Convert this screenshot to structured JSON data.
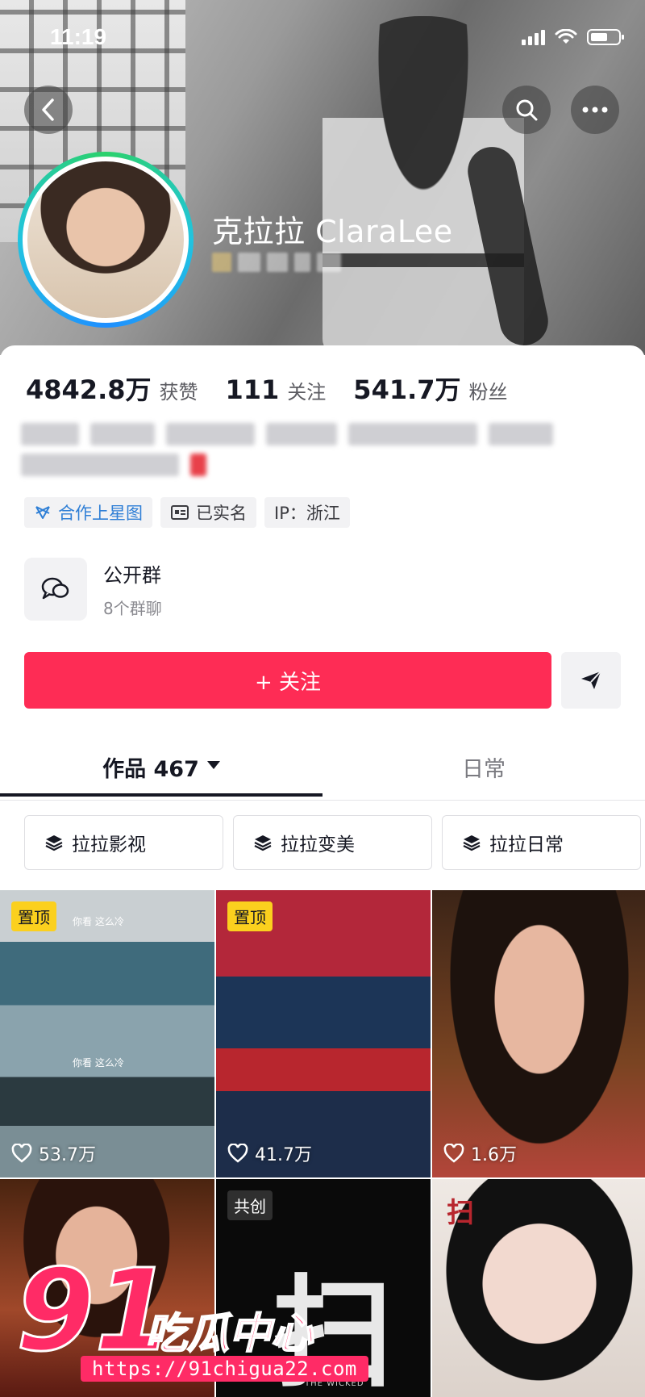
{
  "status_bar": {
    "time": "11:19"
  },
  "profile": {
    "username": "克拉拉 ClaraLee",
    "stats": [
      {
        "value": "4842.8万",
        "label": "获赞"
      },
      {
        "value": "111",
        "label": "关注"
      },
      {
        "value": "541.7万",
        "label": "粉丝"
      }
    ],
    "tags": [
      {
        "icon": "star-map-icon",
        "label": "合作上星图"
      },
      {
        "icon": "id-card-icon",
        "label": "已实名"
      },
      {
        "icon": "",
        "label": "IP：浙江"
      }
    ],
    "group": {
      "title": "公开群",
      "subtitle": "8个群聊"
    },
    "follow_label": "+ 关注"
  },
  "tabs": [
    {
      "label": "作品 467",
      "active": true
    },
    {
      "label": "日常",
      "active": false
    }
  ],
  "collections": [
    {
      "icon": "layers-icon",
      "label": "拉拉影视"
    },
    {
      "icon": "layers-icon",
      "label": "拉拉变美"
    },
    {
      "icon": "layers-icon",
      "label": "拉拉日常"
    }
  ],
  "videos": [
    {
      "badge": "置顶",
      "likes": "53.7万",
      "captions": [
        "你看   这么冷",
        "你看   这么冷"
      ]
    },
    {
      "badge": "置顶",
      "likes": "41.7万"
    },
    {
      "badge": "",
      "likes": "1.6万"
    },
    {
      "badge": "",
      "likes": ""
    },
    {
      "badge": "共创",
      "likes": "",
      "title_char": "扫",
      "subtitle": "THE WICKED"
    },
    {
      "badge": "",
      "likes": "",
      "mark": "扫"
    }
  ],
  "watermark": {
    "number": "91",
    "text": "吃瓜中心",
    "url": "https://91chigua22.com"
  },
  "colors": {
    "follow": "#fe2c55",
    "pin_badge": "#fbd01e",
    "tag_blue": "#2f7fd6",
    "watermark": "#ff2b66"
  }
}
